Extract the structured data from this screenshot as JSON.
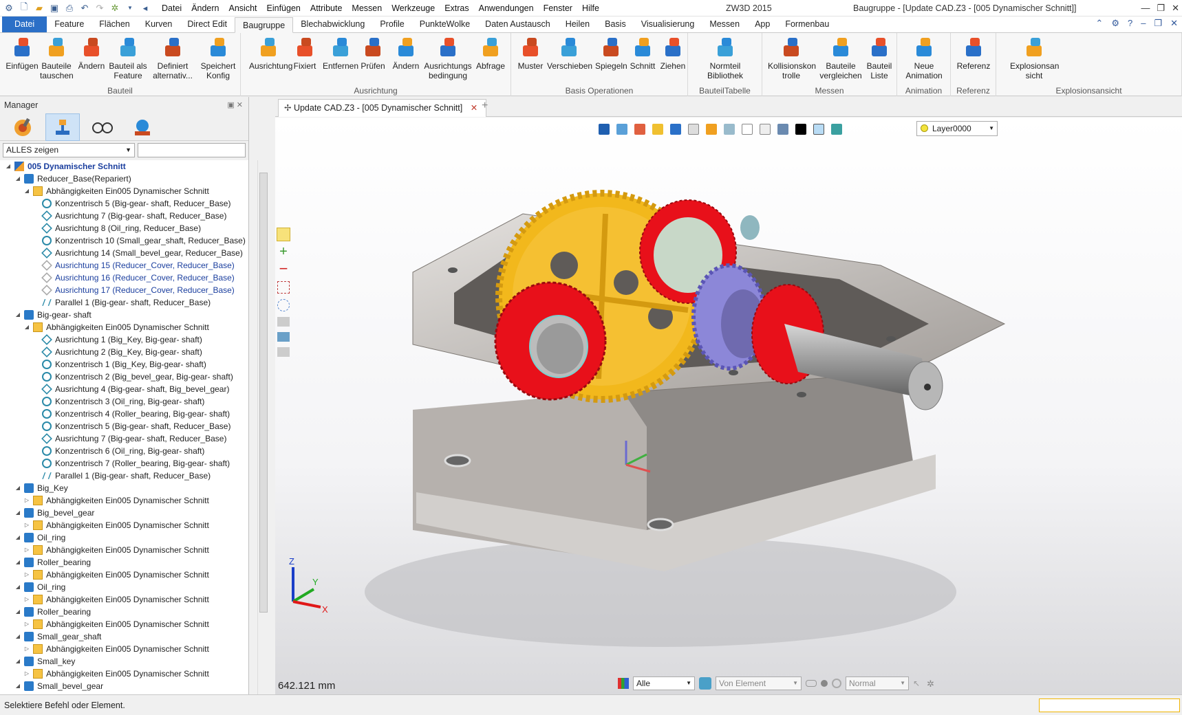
{
  "menubar": [
    "Datei",
    "Ändern",
    "Ansicht",
    "Einfügen",
    "Attribute",
    "Messen",
    "Werkzeuge",
    "Extras",
    "Anwendungen",
    "Fenster",
    "Hilfe"
  ],
  "app_title": "ZW3D 2015",
  "doc_title": "Baugruppe - [Update CAD.Z3 - [005 Dynamischer Schnitt]]",
  "ribbon_tabs": [
    "Datei",
    "Feature",
    "Flächen",
    "Kurven",
    "Direct Edit",
    "Baugruppe",
    "Blechabwicklung",
    "Profile",
    "PunkteWolke",
    "Daten Austausch",
    "Heilen",
    "Basis",
    "Visualisierung",
    "Messen",
    "App",
    "Formenbau"
  ],
  "ribbon_active": "Baugruppe",
  "ribbon_groups": [
    {
      "label": "Bauteil",
      "buttons": [
        [
          "Einfügen",
          ""
        ],
        [
          "Bauteile",
          "tauschen"
        ],
        [
          "Ändern",
          ""
        ],
        [
          "Bauteil als",
          "Feature"
        ],
        [
          "Definiert",
          "alternativ..."
        ],
        [
          "Speichert",
          "Konfig"
        ]
      ]
    },
    {
      "label": "Ausrichtung",
      "buttons": [
        [
          "Ausrichtung",
          ""
        ],
        [
          "Fixiert",
          ""
        ],
        [
          "Entfernen",
          ""
        ],
        [
          "Prüfen",
          ""
        ],
        [
          "Ändern",
          ""
        ],
        [
          "Ausrichtungs",
          "bedingung"
        ],
        [
          "Abfrage",
          ""
        ]
      ]
    },
    {
      "label": "Basis Operationen",
      "buttons": [
        [
          "Muster",
          ""
        ],
        [
          "Verschieben",
          ""
        ],
        [
          "Spiegeln",
          ""
        ],
        [
          "Schnitt",
          ""
        ],
        [
          "Ziehen",
          ""
        ]
      ]
    },
    {
      "label": "BauteilTabelle",
      "buttons": [
        [
          "Normteil",
          "Bibliothek"
        ]
      ]
    },
    {
      "label": "Messen",
      "buttons": [
        [
          "Kollisionskon",
          "trolle"
        ],
        [
          "Bauteile",
          "vergleichen"
        ],
        [
          "Bauteil",
          "Liste"
        ]
      ]
    },
    {
      "label": "Animation",
      "buttons": [
        [
          "Neue",
          "Animation"
        ]
      ]
    },
    {
      "label": "Referenz",
      "buttons": [
        [
          "Referenz",
          ""
        ]
      ]
    },
    {
      "label": "Explosionsansicht",
      "buttons": [
        [
          "Explosionsan",
          "sicht"
        ]
      ]
    }
  ],
  "manager": {
    "title": "Manager",
    "filter_value": "ALLES zeigen",
    "filter_input": ""
  },
  "tree": [
    {
      "level": 0,
      "text": "005 Dynamischer Schnitt",
      "type": "root"
    },
    {
      "level": 1,
      "text": "Reducer_Base(Repariert)",
      "type": "part"
    },
    {
      "level": 2,
      "text": "Abhängigkeiten Ein005 Dynamischer Schnitt",
      "type": "folder"
    },
    {
      "level": 3,
      "text": "Konzentrisch 5 (Big-gear- shaft, Reducer_Base)",
      "type": "conc"
    },
    {
      "level": 3,
      "text": "Ausrichtung 7 (Big-gear- shaft, Reducer_Base)",
      "type": "align"
    },
    {
      "level": 3,
      "text": "Ausrichtung 8 (Oil_ring, Reducer_Base)",
      "type": "align"
    },
    {
      "level": 3,
      "text": "Konzentrisch 10 (Small_gear_shaft, Reducer_Base)",
      "type": "conc"
    },
    {
      "level": 3,
      "text": "Ausrichtung 14 (Small_bevel_gear, Reducer_Base)",
      "type": "align"
    },
    {
      "level": 3,
      "text": "Ausrichtung 15 (Reducer_Cover, Reducer_Base)",
      "type": "align-blue"
    },
    {
      "level": 3,
      "text": "Ausrichtung 16 (Reducer_Cover, Reducer_Base)",
      "type": "align-blue"
    },
    {
      "level": 3,
      "text": "Ausrichtung 17 (Reducer_Cover, Reducer_Base)",
      "type": "align-blue"
    },
    {
      "level": 3,
      "text": "Parallel 1 (Big-gear- shaft, Reducer_Base)",
      "type": "par"
    },
    {
      "level": 1,
      "text": "Big-gear- shaft",
      "type": "part"
    },
    {
      "level": 2,
      "text": "Abhängigkeiten Ein005 Dynamischer Schnitt",
      "type": "folder"
    },
    {
      "level": 3,
      "text": "Ausrichtung 1 (Big_Key, Big-gear- shaft)",
      "type": "align"
    },
    {
      "level": 3,
      "text": "Ausrichtung 2 (Big_Key, Big-gear- shaft)",
      "type": "align"
    },
    {
      "level": 3,
      "text": "Konzentrisch 1 (Big_Key, Big-gear- shaft)",
      "type": "conc"
    },
    {
      "level": 3,
      "text": "Konzentrisch 2 (Big_bevel_gear, Big-gear- shaft)",
      "type": "conc"
    },
    {
      "level": 3,
      "text": "Ausrichtung 4 (Big-gear- shaft, Big_bevel_gear)",
      "type": "align"
    },
    {
      "level": 3,
      "text": "Konzentrisch 3 (Oil_ring, Big-gear- shaft)",
      "type": "conc"
    },
    {
      "level": 3,
      "text": "Konzentrisch 4 (Roller_bearing, Big-gear- shaft)",
      "type": "conc"
    },
    {
      "level": 3,
      "text": "Konzentrisch 5 (Big-gear- shaft, Reducer_Base)",
      "type": "conc"
    },
    {
      "level": 3,
      "text": "Ausrichtung 7 (Big-gear- shaft, Reducer_Base)",
      "type": "align"
    },
    {
      "level": 3,
      "text": "Konzentrisch 6 (Oil_ring, Big-gear- shaft)",
      "type": "conc"
    },
    {
      "level": 3,
      "text": "Konzentrisch 7 (Roller_bearing, Big-gear- shaft)",
      "type": "conc"
    },
    {
      "level": 3,
      "text": "Parallel 1 (Big-gear- shaft, Reducer_Base)",
      "type": "par"
    },
    {
      "level": 1,
      "text": "Big_Key",
      "type": "part"
    },
    {
      "level": 2,
      "text": "Abhängigkeiten Ein005 Dynamischer Schnitt",
      "type": "folder-c"
    },
    {
      "level": 1,
      "text": "Big_bevel_gear",
      "type": "part"
    },
    {
      "level": 2,
      "text": "Abhängigkeiten Ein005 Dynamischer Schnitt",
      "type": "folder-c"
    },
    {
      "level": 1,
      "text": "Oil_ring",
      "type": "part"
    },
    {
      "level": 2,
      "text": "Abhängigkeiten Ein005 Dynamischer Schnitt",
      "type": "folder-c"
    },
    {
      "level": 1,
      "text": "Roller_bearing",
      "type": "part"
    },
    {
      "level": 2,
      "text": "Abhängigkeiten Ein005 Dynamischer Schnitt",
      "type": "folder-c"
    },
    {
      "level": 1,
      "text": "Oil_ring",
      "type": "part"
    },
    {
      "level": 2,
      "text": "Abhängigkeiten Ein005 Dynamischer Schnitt",
      "type": "folder-c"
    },
    {
      "level": 1,
      "text": "Roller_bearing",
      "type": "part"
    },
    {
      "level": 2,
      "text": "Abhängigkeiten Ein005 Dynamischer Schnitt",
      "type": "folder-c"
    },
    {
      "level": 1,
      "text": "Small_gear_shaft",
      "type": "part"
    },
    {
      "level": 2,
      "text": "Abhängigkeiten Ein005 Dynamischer Schnitt",
      "type": "folder-c"
    },
    {
      "level": 1,
      "text": "Small_key",
      "type": "part"
    },
    {
      "level": 2,
      "text": "Abhängigkeiten Ein005 Dynamischer Schnitt",
      "type": "folder-c"
    },
    {
      "level": 1,
      "text": "Small_bevel_gear",
      "type": "part"
    }
  ],
  "doc_tab": "Update CAD.Z3 - [005 Dynamischer Schnitt]",
  "layer": "Layer0000",
  "measure_readout": "642.121 mm",
  "bottom": {
    "filter": "Alle",
    "pick": "Von Element",
    "mode": "Normal"
  },
  "axis_labels": {
    "x": "X",
    "y": "Y",
    "z": "Z"
  },
  "status_text": "Selektiere Befehl oder Element.",
  "colors": {
    "accent": "#2b6fc7",
    "gear_yellow": "#f2b81c",
    "bearing_red": "#e8101a",
    "bevel_purple": "#8c87d8",
    "housing_gray": "#c9c5c2"
  }
}
